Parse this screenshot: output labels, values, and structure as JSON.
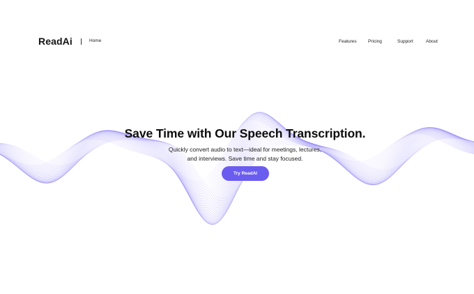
{
  "brand": {
    "name": "ReadAi",
    "accent_color": "#6b5cf0",
    "wave_color": "#7a6cf2"
  },
  "nav": {
    "home": "Home",
    "items": [
      {
        "label": "Features"
      },
      {
        "label": "Pricing"
      },
      {
        "label": "Support"
      },
      {
        "label": "About"
      }
    ]
  },
  "hero": {
    "title": "Save Time with Our Speech Transcription.",
    "subtitle_line1": "Quickly convert audio to text—ideal for meetings, lectures,",
    "subtitle_line2": "and interviews. Save time and stay focused.",
    "cta_label": "Try ReadAI"
  }
}
